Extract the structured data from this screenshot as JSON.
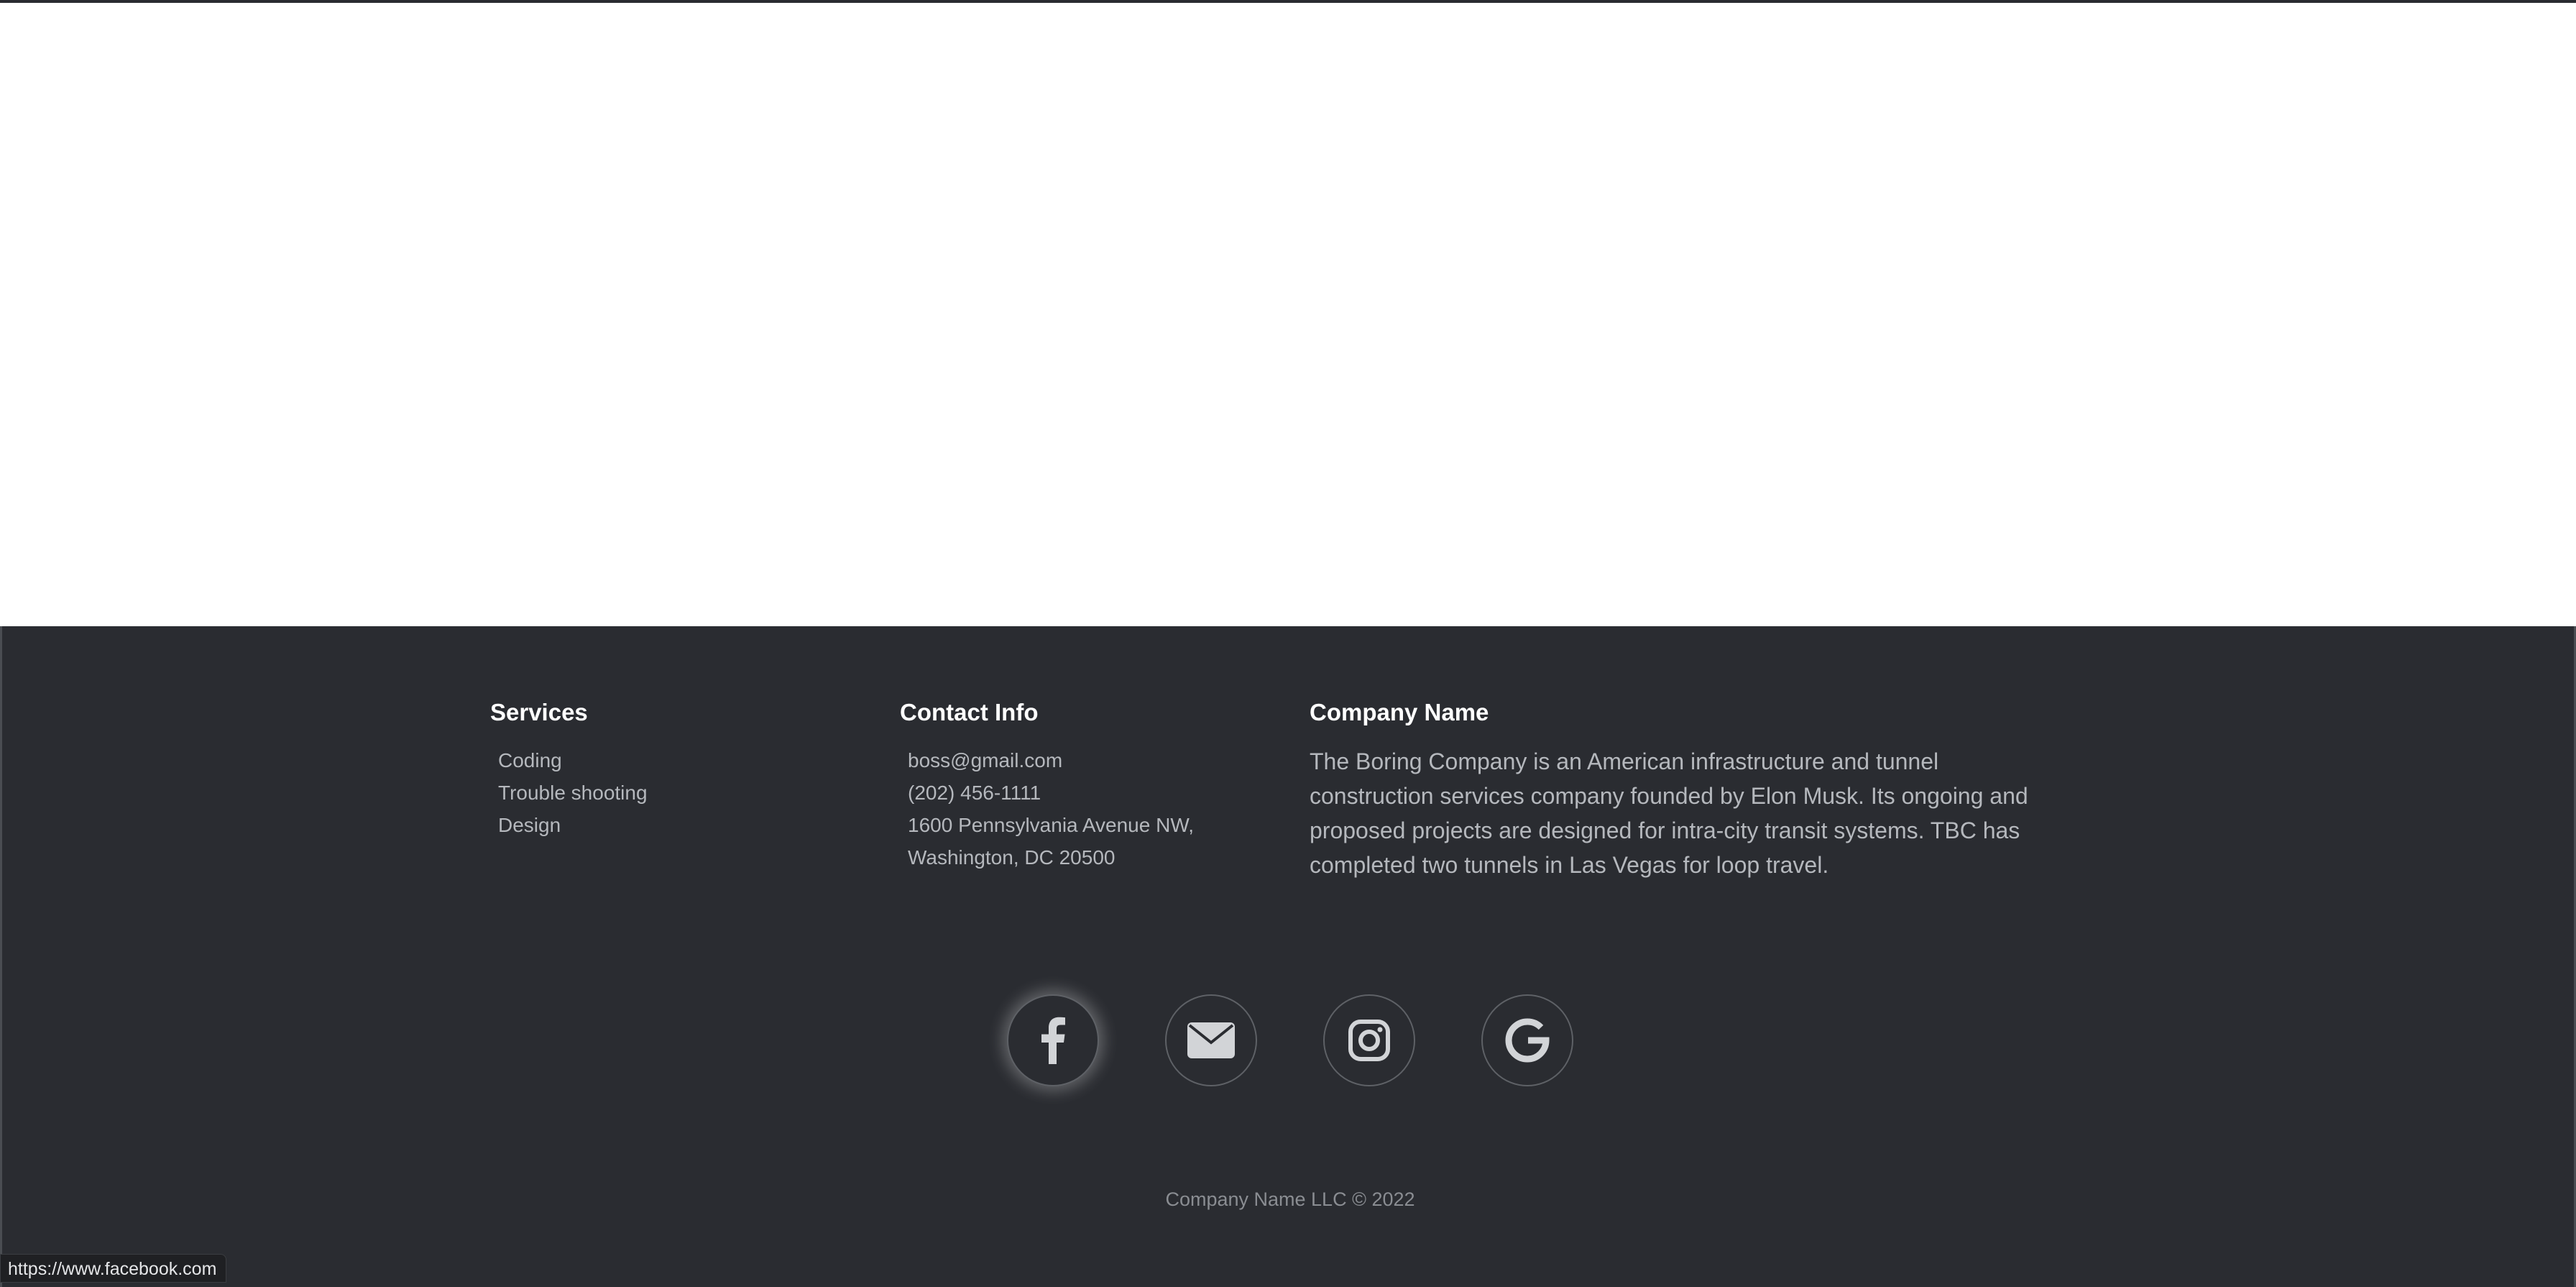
{
  "footer": {
    "services": {
      "heading": "Services",
      "items": [
        "Coding",
        "Trouble shooting",
        "Design"
      ]
    },
    "contact": {
      "heading": "Contact Info",
      "email": "boss@gmail.com",
      "phone": "(202) 456-1111",
      "address_line1": "1600 Pennsylvania Avenue NW,",
      "address_line2": "Washington, DC 20500"
    },
    "company": {
      "heading": "Company Name",
      "description": "The Boring Company is an American infrastructure and tunnel construction services company founded by Elon Musk. Its ongoing and proposed projects are designed for intra-city transit systems. TBC has completed two tunnels in Las Vegas for loop travel."
    },
    "social": [
      {
        "icon": "facebook-icon"
      },
      {
        "icon": "envelope-icon"
      },
      {
        "icon": "instagram-icon"
      },
      {
        "icon": "google-icon"
      }
    ],
    "copyright": "Company Name LLC © 2022"
  },
  "status_bar": {
    "url": "https://www.facebook.com"
  },
  "colors": {
    "footer_bg": "#2a2c31",
    "heading": "#ffffff",
    "text": "#b5b8bd",
    "muted": "#8a8d92"
  }
}
